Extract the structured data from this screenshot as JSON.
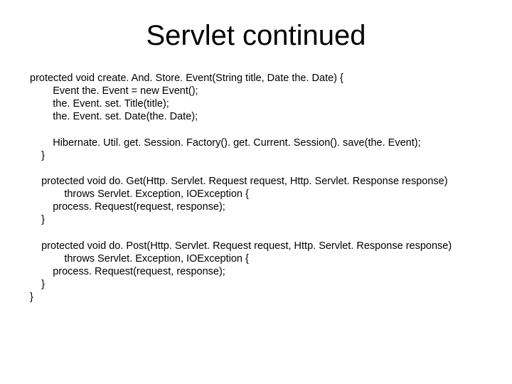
{
  "title": "Servlet continued",
  "code": {
    "l1": "protected void create. And. Store. Event(String title, Date the. Date) {",
    "l2": "        Event the. Event = new Event();",
    "l3": "        the. Event. set. Title(title);",
    "l4": "        the. Event. set. Date(the. Date);",
    "l5": "",
    "l6": "        Hibernate. Util. get. Session. Factory(). get. Current. Session(). save(the. Event);",
    "l7": "    }",
    "l8": "",
    "l9": "    protected void do. Get(Http. Servlet. Request request, Http. Servlet. Response response)",
    "l10": "            throws Servlet. Exception, IOException {",
    "l11": "        process. Request(request, response);",
    "l12": "    }",
    "l13": "",
    "l14": "    protected void do. Post(Http. Servlet. Request request, Http. Servlet. Response response)",
    "l15": "            throws Servlet. Exception, IOException {",
    "l16": "        process. Request(request, response);",
    "l17": "    }",
    "l18": "}"
  }
}
